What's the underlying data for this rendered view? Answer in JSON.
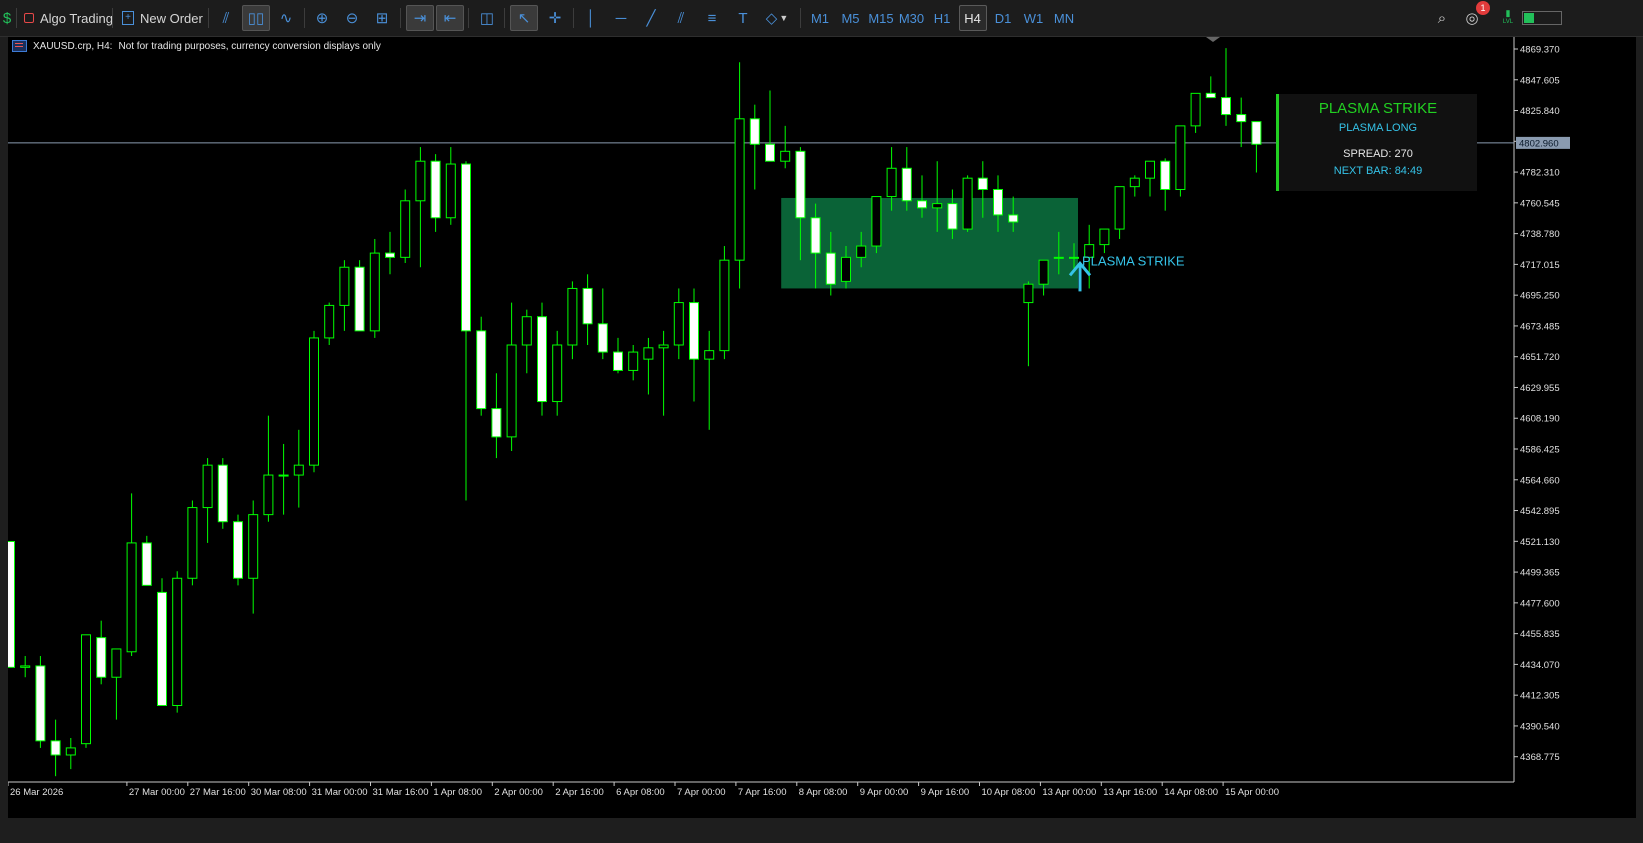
{
  "toolbar": {
    "algo_trading": "Algo Trading",
    "new_order": "New Order",
    "timeframes": [
      "M1",
      "M5",
      "M15",
      "M30",
      "H1",
      "H4",
      "D1",
      "W1",
      "MN"
    ],
    "active_timeframe": "H4",
    "notification_count": "1",
    "signal_label": "LVL"
  },
  "chart_header": {
    "symbol": "XAUUSD.crp, H4:",
    "notice": "Not for trading purposes, currency conversion displays only"
  },
  "panel": {
    "title": "PLASMA STRIKE",
    "subtitle": "PLASMA LONG",
    "spread": "SPREAD: 270",
    "next_bar": "NEXT BAR: 84:49"
  },
  "colors": {
    "bull_body": "#000000",
    "bear_body": "#ffffff",
    "wick": "#00ff00",
    "zone": "#0b6b3c",
    "signal": "#35c3e8",
    "current_price_line": "#8a9bb0"
  },
  "chart_data": {
    "type": "candlestick",
    "current_price": 4802.96,
    "current_price_label": "4802.960",
    "y_ticks": [
      "4869.370",
      "4847.605",
      "4825.840",
      "4804.075",
      "4782.310",
      "4760.545",
      "4738.780",
      "4717.015",
      "4695.250",
      "4673.485",
      "4651.720",
      "4629.955",
      "4608.190",
      "4586.425",
      "4564.660",
      "4542.895",
      "4521.130",
      "4499.365",
      "4477.600",
      "4455.835",
      "4434.070",
      "4412.305",
      "4390.540",
      "4368.775"
    ],
    "x_labels": [
      "26 Mar 2026",
      "27 Mar 00:00",
      "27 Mar 16:00",
      "30 Mar 08:00",
      "31 Mar 00:00",
      "31 Mar 16:00",
      "1 Apr 08:00",
      "2 Apr 00:00",
      "2 Apr 16:00",
      "6 Apr 08:00",
      "7 Apr 00:00",
      "7 Apr 16:00",
      "8 Apr 08:00",
      "9 Apr 00:00",
      "9 Apr 16:00",
      "10 Apr 08:00",
      "13 Apr 00:00",
      "13 Apr 16:00",
      "14 Apr 08:00",
      "15 Apr 00:00"
    ],
    "candles": [
      [
        4521,
        4521,
        4432,
        4432
      ],
      [
        4432,
        4440,
        4425,
        4433
      ],
      [
        4433,
        4440,
        4375,
        4380
      ],
      [
        4380,
        4395,
        4355,
        4370
      ],
      [
        4370,
        4382,
        4360,
        4375
      ],
      [
        4378,
        4455,
        4375,
        4455
      ],
      [
        4453,
        4465,
        4420,
        4425
      ],
      [
        4425,
        4445,
        4395,
        4445
      ],
      [
        4443,
        4555,
        4440,
        4520
      ],
      [
        4520,
        4525,
        4490,
        4490
      ],
      [
        4485,
        4495,
        4415,
        4405
      ],
      [
        4405,
        4500,
        4400,
        4495
      ],
      [
        4495,
        4550,
        4490,
        4545
      ],
      [
        4545,
        4580,
        4520,
        4575
      ],
      [
        4575,
        4580,
        4530,
        4535
      ],
      [
        4535,
        4540,
        4490,
        4495
      ],
      [
        4495,
        4550,
        4470,
        4540
      ],
      [
        4540,
        4610,
        4535,
        4568
      ],
      [
        4568,
        4590,
        4540,
        4568
      ],
      [
        4568,
        4600,
        4545,
        4575
      ],
      [
        4575,
        4670,
        4570,
        4665
      ],
      [
        4665,
        4690,
        4660,
        4688
      ],
      [
        4688,
        4720,
        4670,
        4715
      ],
      [
        4715,
        4720,
        4670,
        4670
      ],
      [
        4670,
        4735,
        4665,
        4725
      ],
      [
        4725,
        4740,
        4710,
        4722
      ],
      [
        4722,
        4770,
        4718,
        4762
      ],
      [
        4762,
        4800,
        4715,
        4790
      ],
      [
        4790,
        4795,
        4740,
        4750
      ],
      [
        4750,
        4800,
        4745,
        4788
      ],
      [
        4788,
        4790,
        4550,
        4670
      ],
      [
        4670,
        4680,
        4610,
        4615
      ],
      [
        4615,
        4640,
        4580,
        4595
      ],
      [
        4595,
        4690,
        4585,
        4660
      ],
      [
        4660,
        4685,
        4640,
        4680
      ],
      [
        4680,
        4690,
        4610,
        4620
      ],
      [
        4620,
        4670,
        4610,
        4660
      ],
      [
        4660,
        4705,
        4650,
        4700
      ],
      [
        4700,
        4710,
        4660,
        4675
      ],
      [
        4675,
        4700,
        4650,
        4655
      ],
      [
        4655,
        4665,
        4640,
        4642
      ],
      [
        4642,
        4660,
        4635,
        4655
      ],
      [
        4650,
        4665,
        4625,
        4658
      ],
      [
        4658,
        4670,
        4610,
        4660
      ],
      [
        4660,
        4700,
        4650,
        4690
      ],
      [
        4690,
        4700,
        4620,
        4650
      ],
      [
        4650,
        4670,
        4600,
        4656
      ],
      [
        4656,
        4730,
        4650,
        4720
      ],
      [
        4720,
        4860,
        4700,
        4820
      ],
      [
        4820,
        4830,
        4770,
        4802
      ],
      [
        4802,
        4840,
        4795,
        4790
      ],
      [
        4790,
        4815,
        4785,
        4797
      ],
      [
        4797,
        4800,
        4720,
        4750
      ],
      [
        4750,
        4760,
        4700,
        4725
      ],
      [
        4725,
        4740,
        4695,
        4703
      ],
      [
        4705,
        4730,
        4700,
        4722
      ],
      [
        4722,
        4740,
        4715,
        4730
      ],
      [
        4730,
        4765,
        4725,
        4765
      ],
      [
        4765,
        4800,
        4755,
        4785
      ],
      [
        4785,
        4800,
        4755,
        4762
      ],
      [
        4762,
        4780,
        4750,
        4757
      ],
      [
        4757,
        4790,
        4740,
        4760
      ],
      [
        4760,
        4770,
        4735,
        4742
      ],
      [
        4742,
        4780,
        4740,
        4778
      ],
      [
        4778,
        4790,
        4750,
        4770
      ],
      [
        4770,
        4780,
        4740,
        4752
      ],
      [
        4752,
        4765,
        4740,
        4747
      ],
      [
        4690,
        4705,
        4645,
        4703
      ],
      [
        4703,
        4720,
        4695,
        4720
      ],
      [
        4722,
        4740,
        4710,
        4722
      ],
      [
        4722,
        4732,
        4712,
        4722
      ],
      [
        4722,
        4745,
        4700,
        4731
      ],
      [
        4731,
        4742,
        4725,
        4742
      ],
      [
        4742,
        4760,
        4735,
        4772
      ],
      [
        4772,
        4780,
        4765,
        4778
      ],
      [
        4778,
        4785,
        4765,
        4790
      ],
      [
        4790,
        4792,
        4755,
        4770
      ],
      [
        4770,
        4805,
        4765,
        4815
      ],
      [
        4815,
        4830,
        4810,
        4838
      ],
      [
        4838,
        4850,
        4835,
        4835
      ],
      [
        4835,
        4870,
        4815,
        4823
      ],
      [
        4823,
        4835,
        4800,
        4818
      ],
      [
        4818,
        4805,
        4782,
        4802
      ]
    ],
    "zone": {
      "from_index": 51,
      "to_index": 70,
      "low": 4700,
      "high": 4764
    },
    "signal": {
      "index": 70,
      "price": 4722,
      "label": "PLASMA STRIKE"
    }
  }
}
